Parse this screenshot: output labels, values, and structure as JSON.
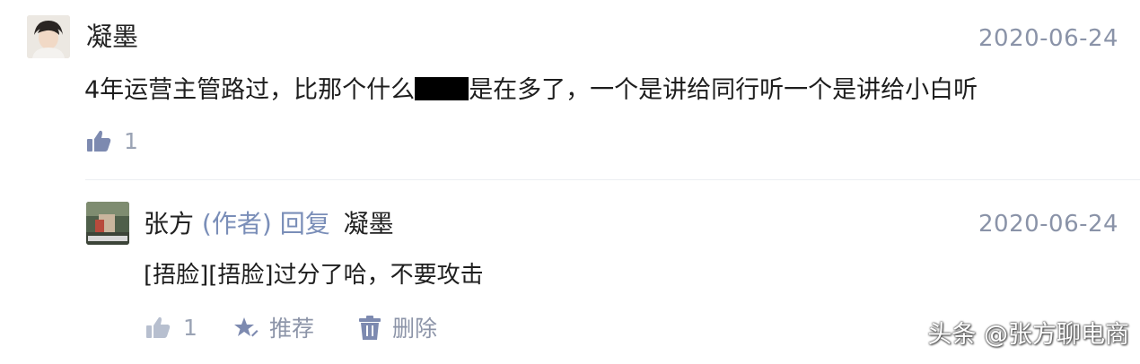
{
  "comment": {
    "author": "凝墨",
    "date": "2020-06-24",
    "text_before": "4年运营主管路过，比那个什么",
    "text_after": "是在多了，一个是讲给同行听一个是讲给小白听",
    "likes": "1",
    "icons": {
      "like": "thumbs-up-icon"
    }
  },
  "reply": {
    "author": "张方",
    "author_tag": "(作者)",
    "reply_word": "回复",
    "reply_to": "凝墨",
    "date": "2020-06-24",
    "text": "[捂脸][捂脸]过分了哈，不要攻击",
    "likes": "1",
    "recommend_label": "推荐",
    "delete_label": "删除",
    "icons": {
      "like": "thumbs-up-icon",
      "recommend": "star-pen-icon",
      "delete": "trash-icon"
    }
  },
  "watermark": "头条 @张方聊电商",
  "colors": {
    "meta_gray": "#8a93a8",
    "author_blue": "#7a8eb8",
    "text": "#1e1e1e"
  }
}
